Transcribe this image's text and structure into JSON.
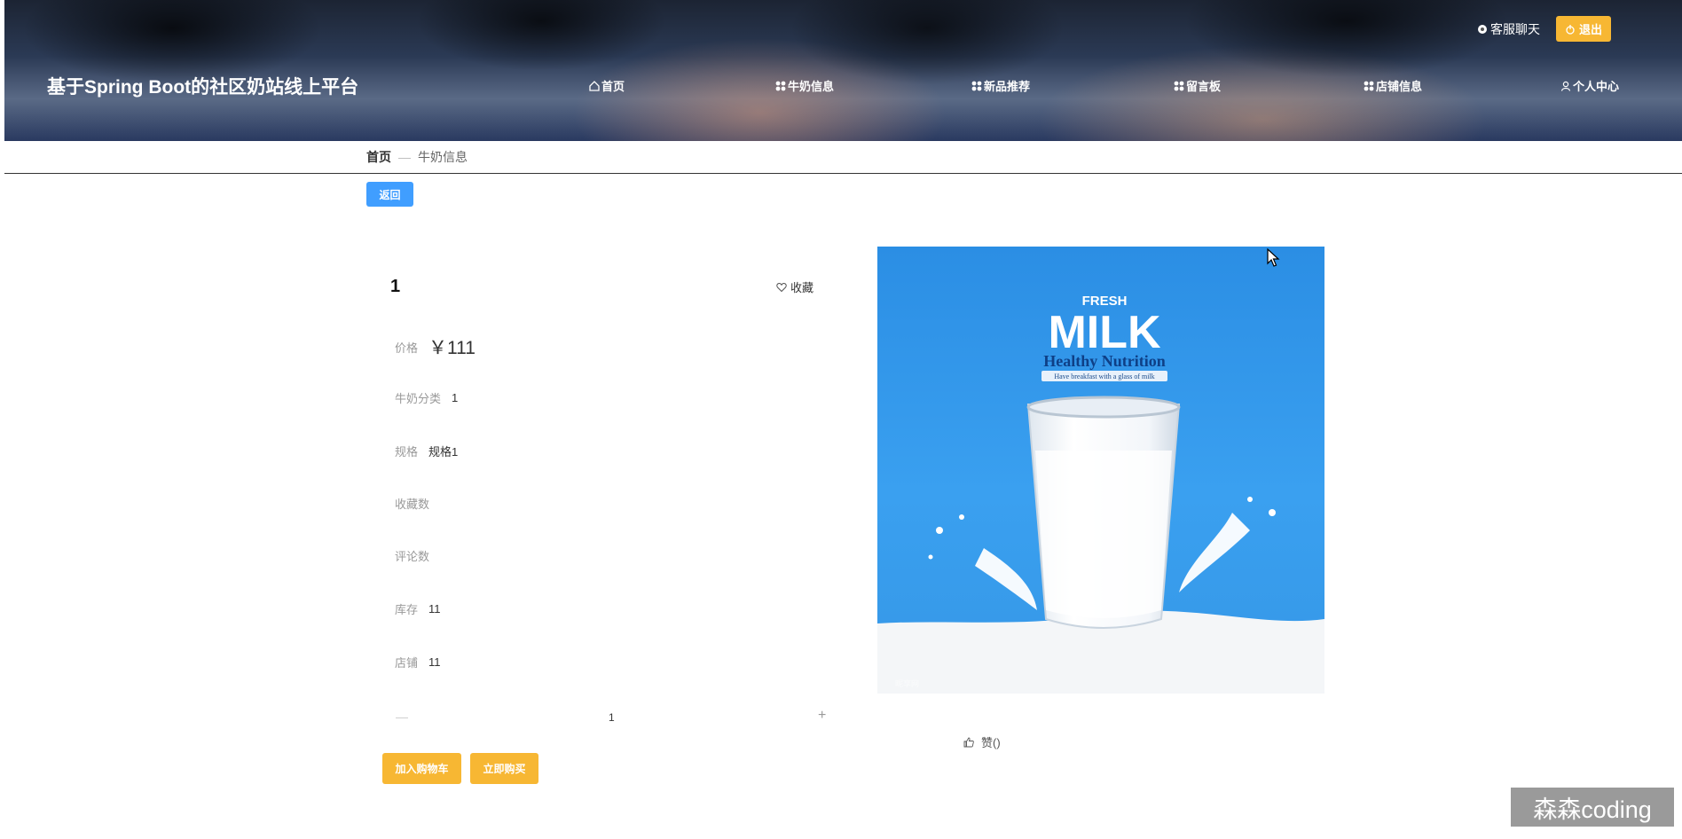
{
  "header": {
    "site_title": "基于Spring Boot的社区奶站线上平台",
    "chat_label": "客服聊天",
    "logout_label": "退出",
    "nav": [
      {
        "label": "首页",
        "icon": "home-icon"
      },
      {
        "label": "牛奶信息",
        "icon": "grid-icon"
      },
      {
        "label": "新品推荐",
        "icon": "grid-icon"
      },
      {
        "label": "留言板",
        "icon": "grid-icon"
      },
      {
        "label": "店铺信息",
        "icon": "grid-icon"
      },
      {
        "label": "个人中心",
        "icon": "user-icon"
      }
    ]
  },
  "breadcrumb": {
    "home": "首页",
    "separator": "—",
    "current": "牛奶信息"
  },
  "back_label": "返回",
  "product": {
    "title": "1",
    "favorite_label": "收藏",
    "fields": {
      "price": {
        "label": "价格",
        "value": "￥111"
      },
      "category": {
        "label": "牛奶分类",
        "value": "1"
      },
      "spec": {
        "label": "规格",
        "value": "规格1"
      },
      "fav_count": {
        "label": "收藏数",
        "value": ""
      },
      "comment_count": {
        "label": "评论数",
        "value": ""
      },
      "stock": {
        "label": "库存",
        "value": "11"
      },
      "shop": {
        "label": "店铺",
        "value": "11"
      }
    },
    "quantity": "1",
    "add_cart_label": "加入购物车",
    "buy_now_label": "立即购买",
    "like_label": "赞()",
    "image_text": {
      "fresh": "FRESH",
      "milk": "MILK",
      "subtitle": "Healthy Nutrition",
      "tagline": "Have breakfast with a glass of milk"
    }
  },
  "watermark": "森森coding",
  "colors": {
    "primary": "#409eff",
    "accent": "#f7b733",
    "price": "#cc0000"
  }
}
